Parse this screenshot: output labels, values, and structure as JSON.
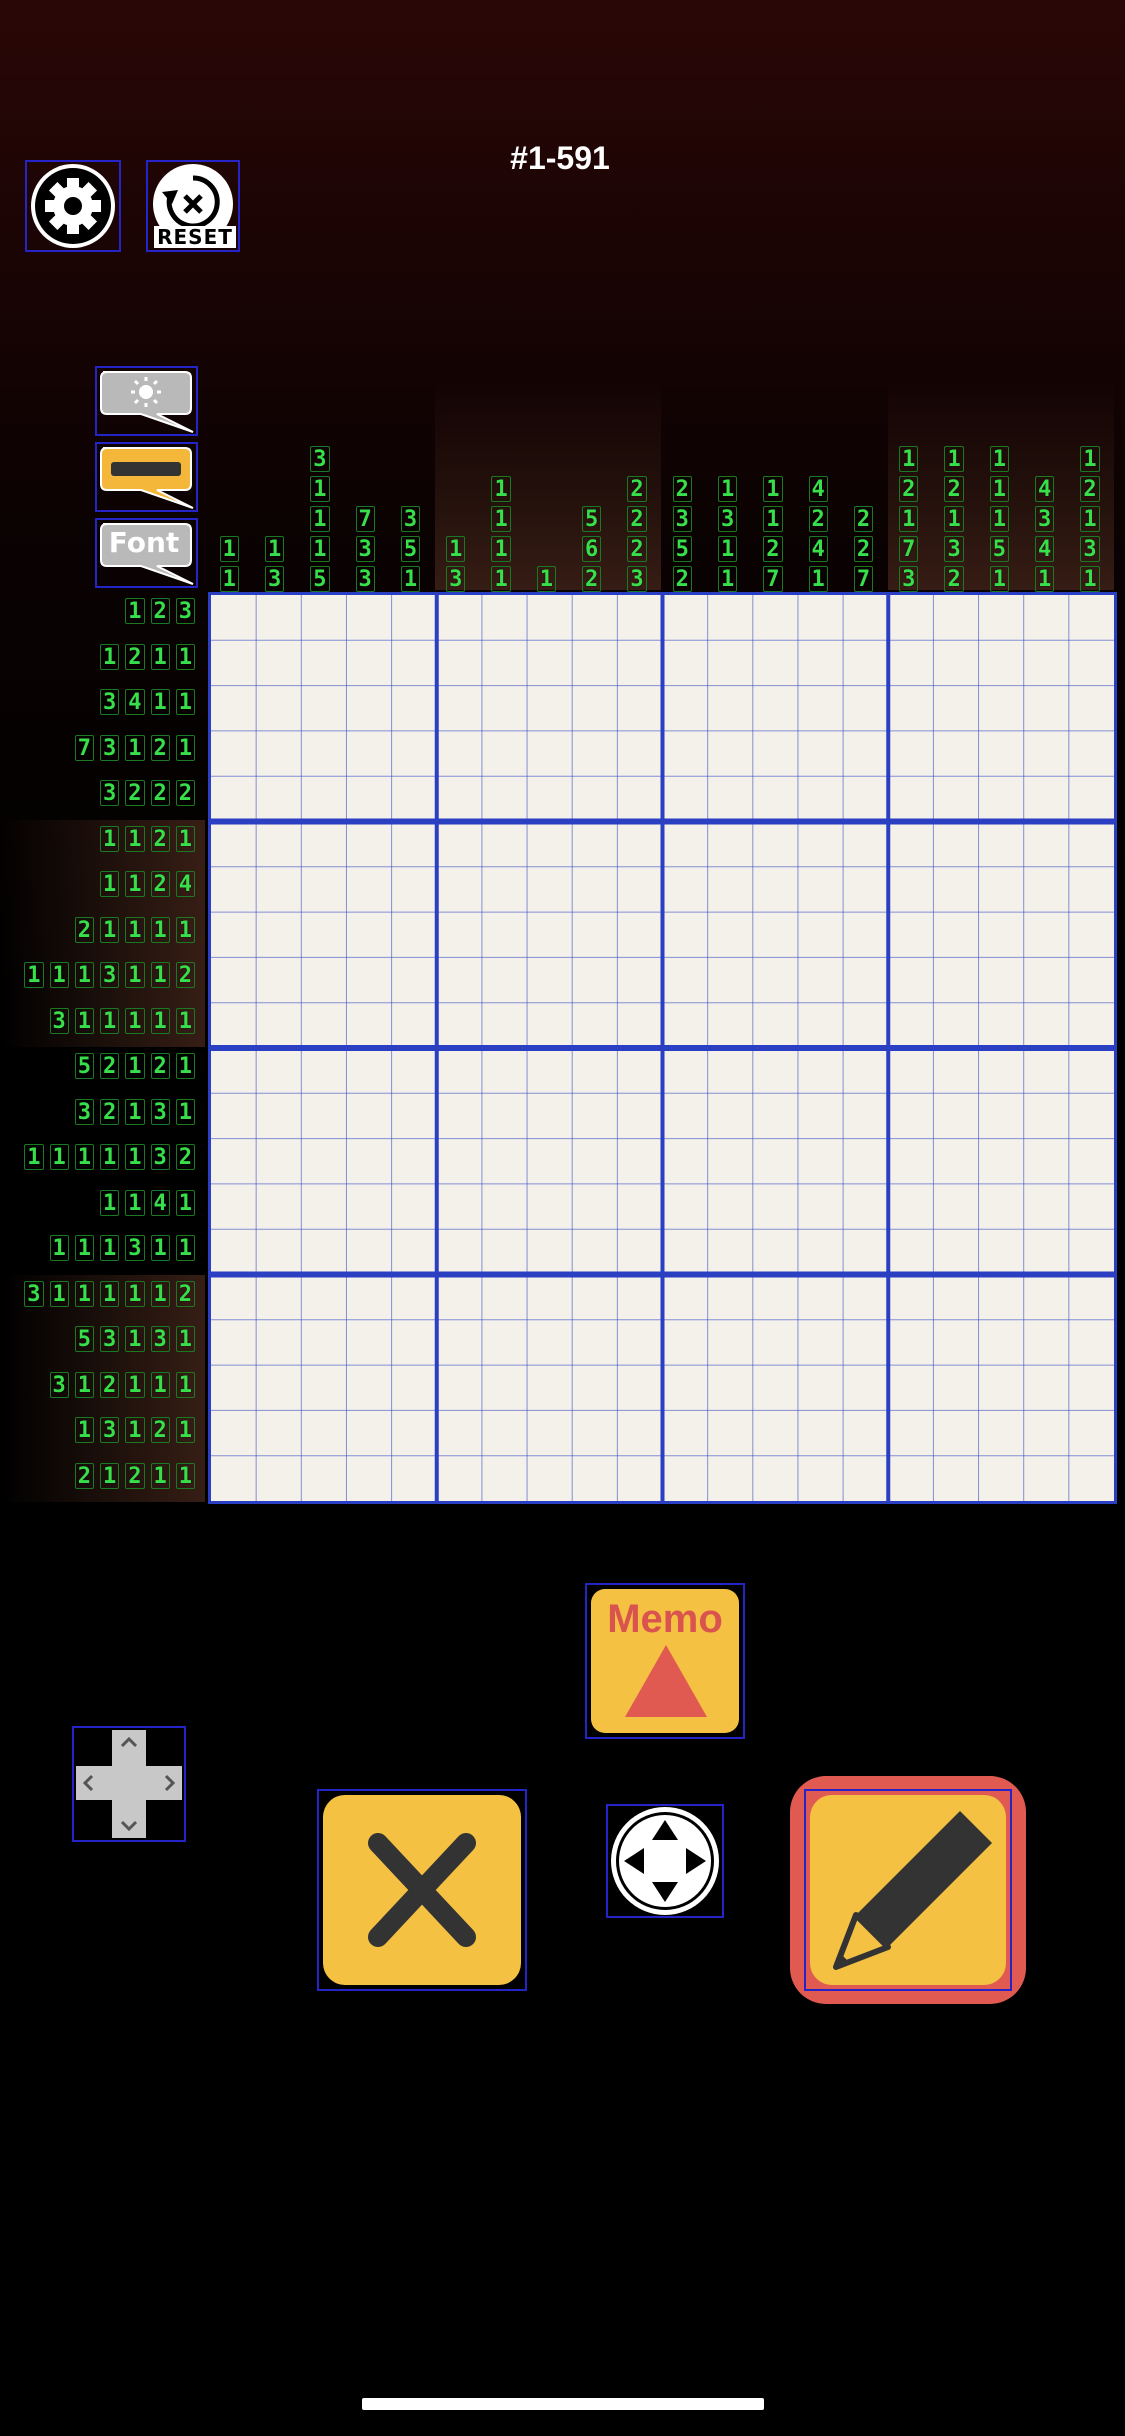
{
  "puzzle_id": "#1-591",
  "reset_label": "RESET",
  "font_label": "Font",
  "memo_label": "Memo",
  "colors": {
    "clue_green": "#37e04a",
    "grid_line": "#2a3fc2",
    "cell_bg": "#f3f1ea",
    "button_yellow": "#f4c142",
    "pencil_active": "#e05a52"
  },
  "column_clues": [
    [
      "1",
      "1"
    ],
    [
      "1",
      "3"
    ],
    [
      "3",
      "1",
      "1",
      "1",
      "5"
    ],
    [
      "7",
      "3",
      "3"
    ],
    [
      "3",
      "5",
      "1"
    ],
    [
      "1",
      "3"
    ],
    [
      "1",
      "1",
      "1",
      "1"
    ],
    [
      "1"
    ],
    [
      "5",
      "6",
      "2"
    ],
    [
      "2",
      "2",
      "2",
      "3"
    ],
    [
      "2",
      "3",
      "5",
      "2"
    ],
    [
      "1",
      "3",
      "1",
      "1"
    ],
    [
      "1",
      "1",
      "2",
      "7"
    ],
    [
      "4",
      "2",
      "4",
      "1"
    ],
    [
      "2",
      "2",
      "7"
    ],
    [
      "1",
      "2",
      "1",
      "7",
      "3"
    ],
    [
      "1",
      "2",
      "1",
      "3",
      "2"
    ],
    [
      "1",
      "1",
      "1",
      "5",
      "1"
    ],
    [
      "4",
      "3",
      "4",
      "1"
    ],
    [
      "1",
      "2",
      "1",
      "3",
      "1"
    ]
  ],
  "row_clues": [
    [
      "1",
      "2",
      "3"
    ],
    [
      "1",
      "2",
      "1",
      "1"
    ],
    [
      "3",
      "4",
      "1",
      "1"
    ],
    [
      "7",
      "3",
      "1",
      "2",
      "1"
    ],
    [
      "3",
      "2",
      "2",
      "2"
    ],
    [
      "1",
      "1",
      "2",
      "1"
    ],
    [
      "1",
      "1",
      "2",
      "4"
    ],
    [
      "2",
      "1",
      "1",
      "1",
      "1"
    ],
    [
      "1",
      "1",
      "1",
      "3",
      "1",
      "1",
      "2"
    ],
    [
      "3",
      "1",
      "1",
      "1",
      "1",
      "1"
    ],
    [
      "5",
      "2",
      "1",
      "2",
      "1"
    ],
    [
      "3",
      "2",
      "1",
      "3",
      "1"
    ],
    [
      "1",
      "1",
      "1",
      "1",
      "1",
      "3",
      "2"
    ],
    [
      "1",
      "1",
      "4",
      "1"
    ],
    [
      "1",
      "1",
      "1",
      "3",
      "1",
      "1"
    ],
    [
      "3",
      "1",
      "1",
      "1",
      "1",
      "1",
      "2"
    ],
    [
      "5",
      "3",
      "1",
      "3",
      "1"
    ],
    [
      "3",
      "1",
      "2",
      "1",
      "1",
      "1"
    ],
    [
      "1",
      "3",
      "1",
      "2",
      "1"
    ],
    [
      "2",
      "1",
      "2",
      "1",
      "1"
    ]
  ],
  "grid_size": {
    "rows": 20,
    "cols": 20
  },
  "icons": [
    "settings-gear-icon",
    "reset-icon",
    "brightness-icon",
    "highlight-bar-icon",
    "font-icon",
    "memo-triangle-icon",
    "dpad-icon",
    "cross-icon",
    "move-arrows-icon",
    "pencil-icon"
  ]
}
